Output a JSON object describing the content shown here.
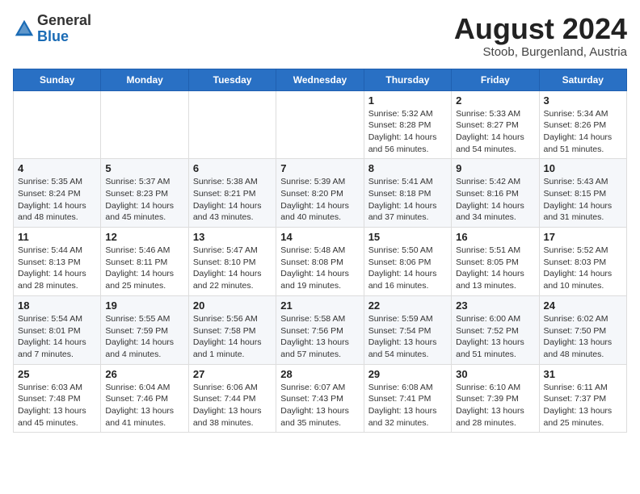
{
  "header": {
    "logo_general": "General",
    "logo_blue": "Blue",
    "month_year": "August 2024",
    "location": "Stoob, Burgenland, Austria"
  },
  "weekdays": [
    "Sunday",
    "Monday",
    "Tuesday",
    "Wednesday",
    "Thursday",
    "Friday",
    "Saturday"
  ],
  "weeks": [
    [
      {
        "day": "",
        "info": ""
      },
      {
        "day": "",
        "info": ""
      },
      {
        "day": "",
        "info": ""
      },
      {
        "day": "",
        "info": ""
      },
      {
        "day": "1",
        "info": "Sunrise: 5:32 AM\nSunset: 8:28 PM\nDaylight: 14 hours\nand 56 minutes."
      },
      {
        "day": "2",
        "info": "Sunrise: 5:33 AM\nSunset: 8:27 PM\nDaylight: 14 hours\nand 54 minutes."
      },
      {
        "day": "3",
        "info": "Sunrise: 5:34 AM\nSunset: 8:26 PM\nDaylight: 14 hours\nand 51 minutes."
      }
    ],
    [
      {
        "day": "4",
        "info": "Sunrise: 5:35 AM\nSunset: 8:24 PM\nDaylight: 14 hours\nand 48 minutes."
      },
      {
        "day": "5",
        "info": "Sunrise: 5:37 AM\nSunset: 8:23 PM\nDaylight: 14 hours\nand 45 minutes."
      },
      {
        "day": "6",
        "info": "Sunrise: 5:38 AM\nSunset: 8:21 PM\nDaylight: 14 hours\nand 43 minutes."
      },
      {
        "day": "7",
        "info": "Sunrise: 5:39 AM\nSunset: 8:20 PM\nDaylight: 14 hours\nand 40 minutes."
      },
      {
        "day": "8",
        "info": "Sunrise: 5:41 AM\nSunset: 8:18 PM\nDaylight: 14 hours\nand 37 minutes."
      },
      {
        "day": "9",
        "info": "Sunrise: 5:42 AM\nSunset: 8:16 PM\nDaylight: 14 hours\nand 34 minutes."
      },
      {
        "day": "10",
        "info": "Sunrise: 5:43 AM\nSunset: 8:15 PM\nDaylight: 14 hours\nand 31 minutes."
      }
    ],
    [
      {
        "day": "11",
        "info": "Sunrise: 5:44 AM\nSunset: 8:13 PM\nDaylight: 14 hours\nand 28 minutes."
      },
      {
        "day": "12",
        "info": "Sunrise: 5:46 AM\nSunset: 8:11 PM\nDaylight: 14 hours\nand 25 minutes."
      },
      {
        "day": "13",
        "info": "Sunrise: 5:47 AM\nSunset: 8:10 PM\nDaylight: 14 hours\nand 22 minutes."
      },
      {
        "day": "14",
        "info": "Sunrise: 5:48 AM\nSunset: 8:08 PM\nDaylight: 14 hours\nand 19 minutes."
      },
      {
        "day": "15",
        "info": "Sunrise: 5:50 AM\nSunset: 8:06 PM\nDaylight: 14 hours\nand 16 minutes."
      },
      {
        "day": "16",
        "info": "Sunrise: 5:51 AM\nSunset: 8:05 PM\nDaylight: 14 hours\nand 13 minutes."
      },
      {
        "day": "17",
        "info": "Sunrise: 5:52 AM\nSunset: 8:03 PM\nDaylight: 14 hours\nand 10 minutes."
      }
    ],
    [
      {
        "day": "18",
        "info": "Sunrise: 5:54 AM\nSunset: 8:01 PM\nDaylight: 14 hours\nand 7 minutes."
      },
      {
        "day": "19",
        "info": "Sunrise: 5:55 AM\nSunset: 7:59 PM\nDaylight: 14 hours\nand 4 minutes."
      },
      {
        "day": "20",
        "info": "Sunrise: 5:56 AM\nSunset: 7:58 PM\nDaylight: 14 hours\nand 1 minute."
      },
      {
        "day": "21",
        "info": "Sunrise: 5:58 AM\nSunset: 7:56 PM\nDaylight: 13 hours\nand 57 minutes."
      },
      {
        "day": "22",
        "info": "Sunrise: 5:59 AM\nSunset: 7:54 PM\nDaylight: 13 hours\nand 54 minutes."
      },
      {
        "day": "23",
        "info": "Sunrise: 6:00 AM\nSunset: 7:52 PM\nDaylight: 13 hours\nand 51 minutes."
      },
      {
        "day": "24",
        "info": "Sunrise: 6:02 AM\nSunset: 7:50 PM\nDaylight: 13 hours\nand 48 minutes."
      }
    ],
    [
      {
        "day": "25",
        "info": "Sunrise: 6:03 AM\nSunset: 7:48 PM\nDaylight: 13 hours\nand 45 minutes."
      },
      {
        "day": "26",
        "info": "Sunrise: 6:04 AM\nSunset: 7:46 PM\nDaylight: 13 hours\nand 41 minutes."
      },
      {
        "day": "27",
        "info": "Sunrise: 6:06 AM\nSunset: 7:44 PM\nDaylight: 13 hours\nand 38 minutes."
      },
      {
        "day": "28",
        "info": "Sunrise: 6:07 AM\nSunset: 7:43 PM\nDaylight: 13 hours\nand 35 minutes."
      },
      {
        "day": "29",
        "info": "Sunrise: 6:08 AM\nSunset: 7:41 PM\nDaylight: 13 hours\nand 32 minutes."
      },
      {
        "day": "30",
        "info": "Sunrise: 6:10 AM\nSunset: 7:39 PM\nDaylight: 13 hours\nand 28 minutes."
      },
      {
        "day": "31",
        "info": "Sunrise: 6:11 AM\nSunset: 7:37 PM\nDaylight: 13 hours\nand 25 minutes."
      }
    ]
  ]
}
